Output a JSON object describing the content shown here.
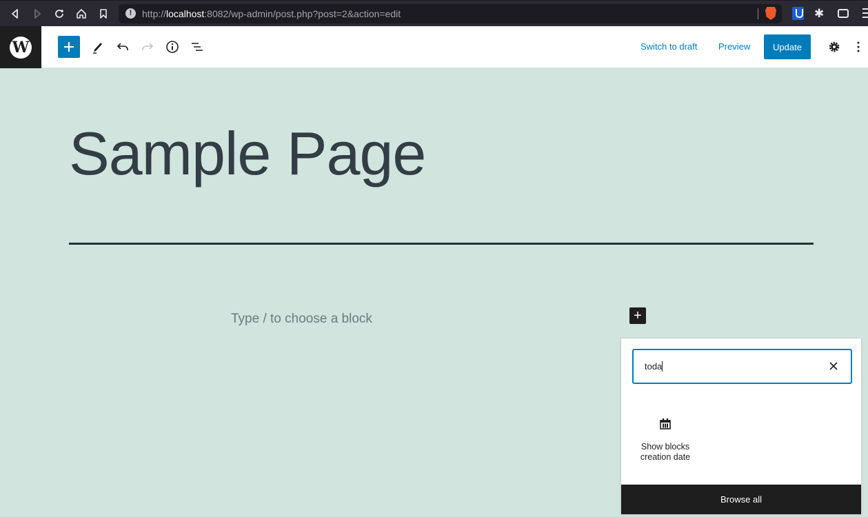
{
  "browser": {
    "url_prefix": "http://",
    "url_host": "localhost",
    "url_rest": ":8082/wp-admin/post.php?post=2&action=edit",
    "info_glyph": "!",
    "extension_glyph": "✱"
  },
  "editor_header": {
    "logo_glyph": "W",
    "tools": {
      "inserter": "add-block",
      "edit": "tools",
      "undo": "undo",
      "redo": "redo",
      "details": "details",
      "list_view": "list-view"
    },
    "switch_to_draft_label": "Switch to draft",
    "preview_label": "Preview",
    "update_label": "Update"
  },
  "canvas": {
    "title": "Sample Page",
    "block_placeholder": "Type / to choose a block",
    "inserter_toggle_glyph": "+"
  },
  "quick_inserter": {
    "search_value": "toda",
    "results": [
      {
        "label": "Show blocks creation date",
        "icon": "calendar-icon"
      }
    ],
    "browse_all_label": "Browse all"
  },
  "colors": {
    "accent": "#007cba",
    "canvas_bg": "#d1e4dd",
    "title_text": "#333d45",
    "dark": "#1e1e1e"
  }
}
